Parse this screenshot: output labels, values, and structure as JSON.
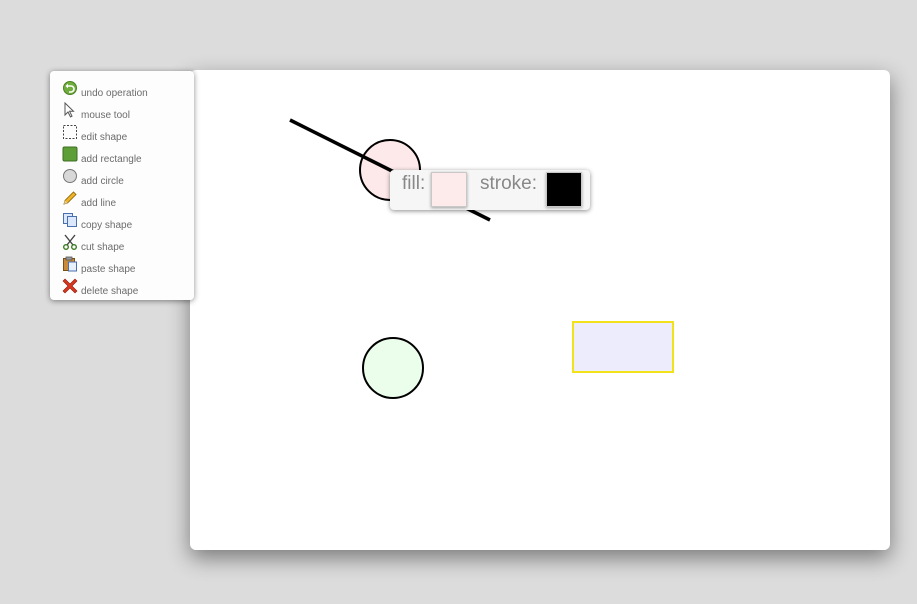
{
  "toolbar": {
    "tools": [
      {
        "id": "undo",
        "label": "undo operation",
        "icon": "undo-icon"
      },
      {
        "id": "mouse",
        "label": "mouse tool",
        "icon": "cursor-arrow-icon"
      },
      {
        "id": "edit",
        "label": "edit shape",
        "icon": "dashed-select-icon"
      },
      {
        "id": "rect",
        "label": "add rectangle",
        "icon": "green-square-icon"
      },
      {
        "id": "circle",
        "label": "add circle",
        "icon": "gray-circle-icon"
      },
      {
        "id": "line",
        "label": "add line",
        "icon": "pencil-icon"
      },
      {
        "id": "copy",
        "label": "copy shape",
        "icon": "copy-icon"
      },
      {
        "id": "cut",
        "label": "cut shape",
        "icon": "scissors-icon"
      },
      {
        "id": "paste",
        "label": "paste shape",
        "icon": "clipboard-icon"
      },
      {
        "id": "delete",
        "label": "delete shape",
        "icon": "red-x-icon"
      }
    ]
  },
  "color_popup": {
    "fill_label": "fill:",
    "stroke_label": "stroke:",
    "fill_color": "#fdeaea",
    "stroke_color": "#000000"
  },
  "shapes": {
    "selected_circle": {
      "fill": "#fde9e9",
      "stroke": "#000000"
    },
    "line": {
      "stroke": "#000000"
    },
    "lower_circle": {
      "fill": "#ebfdeb",
      "stroke": "#000000"
    },
    "rectangle": {
      "fill": "#ececfc",
      "stroke": "#f2e21a"
    }
  },
  "colors": {
    "background": "#dcdcdc",
    "canvas": "#ffffff",
    "toolbar_text": "#6c6c6c"
  }
}
